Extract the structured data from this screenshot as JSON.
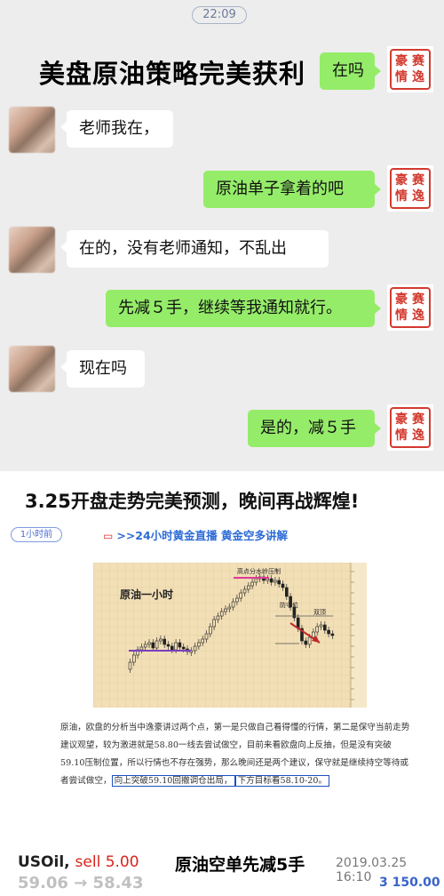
{
  "chat": {
    "time": "22:09",
    "overlay_title": "美盘原油策略完美获利",
    "seal_chars": [
      "豪",
      "赛",
      "情",
      "逸"
    ],
    "messages": [
      {
        "side": "right",
        "text": "在吗"
      },
      {
        "side": "left",
        "text": "老师我在，"
      },
      {
        "side": "right",
        "text": "原油单子拿着的吧"
      },
      {
        "side": "left",
        "text": "在的，没有老师通知，不乱出"
      },
      {
        "side": "right",
        "text": "先减５手，继续等我通知就行。"
      },
      {
        "side": "left",
        "text": "现在吗"
      },
      {
        "side": "right",
        "text": "是的，减５手"
      }
    ]
  },
  "article": {
    "headline": "3.25开盘走势完美预测，晚间再战辉煌!",
    "time_ago": "1小时前",
    "live_link": ">>24小时黄金直播 黄金空多讲解",
    "chart": {
      "title": "原油一小时",
      "label_resistance": "高点分水岭压制",
      "label_defense": "防守位",
      "label_double_top": "双顶"
    },
    "body_pre": "原油，欧盘的分析当中逸豪讲过两个点，第一是只做自己看得懂的行情，第二是保守当前走势建议观望，较为激进就是58.80一线去尝试做空，目前来看欧盘向上反抽，但是没有突破59.10压制位置，所以行情也不存在强势，那么晚间还是两个建议，保守就是继续持空等待或者尝试做空，",
    "body_box1": "向上突破59.10回撤调仓出局，",
    "body_box2": "下方目标看58.10-20。"
  },
  "bottom_bar": {
    "symbol": "USOil,",
    "action": "sell 5.00",
    "title": "原油空单先减5手",
    "date": "2019.03.25 16:10",
    "prices": "59.06 → 58.43",
    "amount": "3 150.00"
  },
  "colors": {
    "chat_bg": "#ededed",
    "bubble_right": "#95ec69",
    "seal_red": "#d23a2f",
    "chart_bg": "#f2dfb6",
    "link_blue": "#2d6bd6",
    "sell_red": "#d8241c"
  }
}
